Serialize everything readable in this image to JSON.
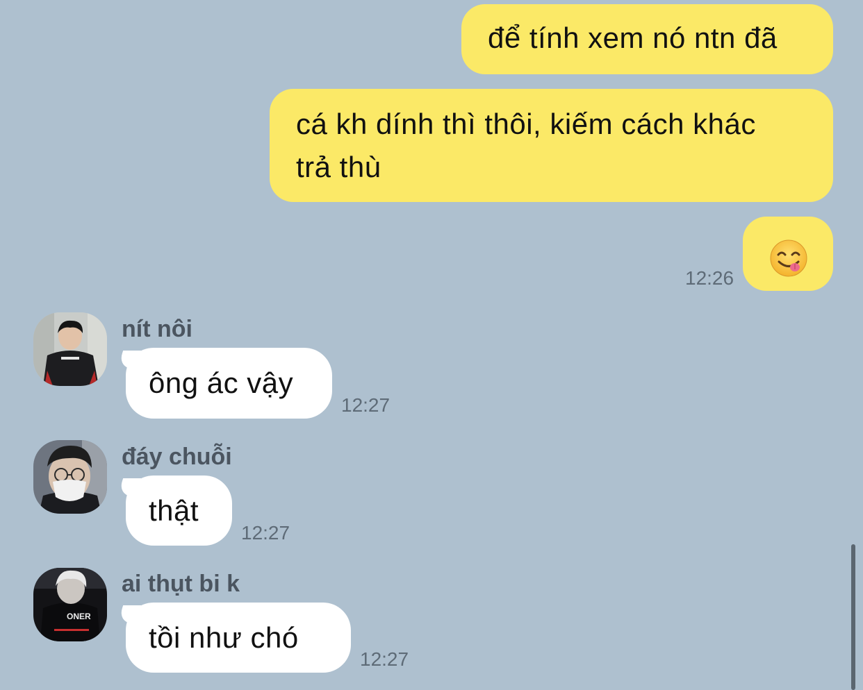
{
  "messages": [
    {
      "id": "m1",
      "direction": "outgoing",
      "text": "để tính xem nó ntn đã"
    },
    {
      "id": "m2",
      "direction": "outgoing",
      "text_lines": [
        "cá kh dính thì thôi, kiếm cách khác",
        "trả thù"
      ]
    },
    {
      "id": "m3",
      "direction": "outgoing",
      "emoji": "face-savoring-food-icon",
      "time": "12:26"
    },
    {
      "id": "m4",
      "direction": "incoming",
      "sender": "nít nôi",
      "text": "ông ác vậy",
      "time": "12:27"
    },
    {
      "id": "m5",
      "direction": "incoming",
      "sender": "đáy chuỗi",
      "text": "thật",
      "time": "12:27"
    },
    {
      "id": "m6",
      "direction": "incoming",
      "sender": "ai thụt bi k",
      "text": "tồi như chó",
      "time": "12:27"
    }
  ],
  "avatars": {
    "a1": {
      "icon": "avatar-photo-person-dark-jacket"
    },
    "a2": {
      "icon": "avatar-photo-person-glasses-mask"
    },
    "a3": {
      "icon": "avatar-photo-person-white-hair",
      "text": "ONER"
    }
  },
  "colors": {
    "background": "#AEC0CF",
    "outgoing_bubble": "#FBE967",
    "incoming_bubble": "#FFFFFF",
    "timestamp": "#5E6B77",
    "sender_name": "#4B5560"
  }
}
